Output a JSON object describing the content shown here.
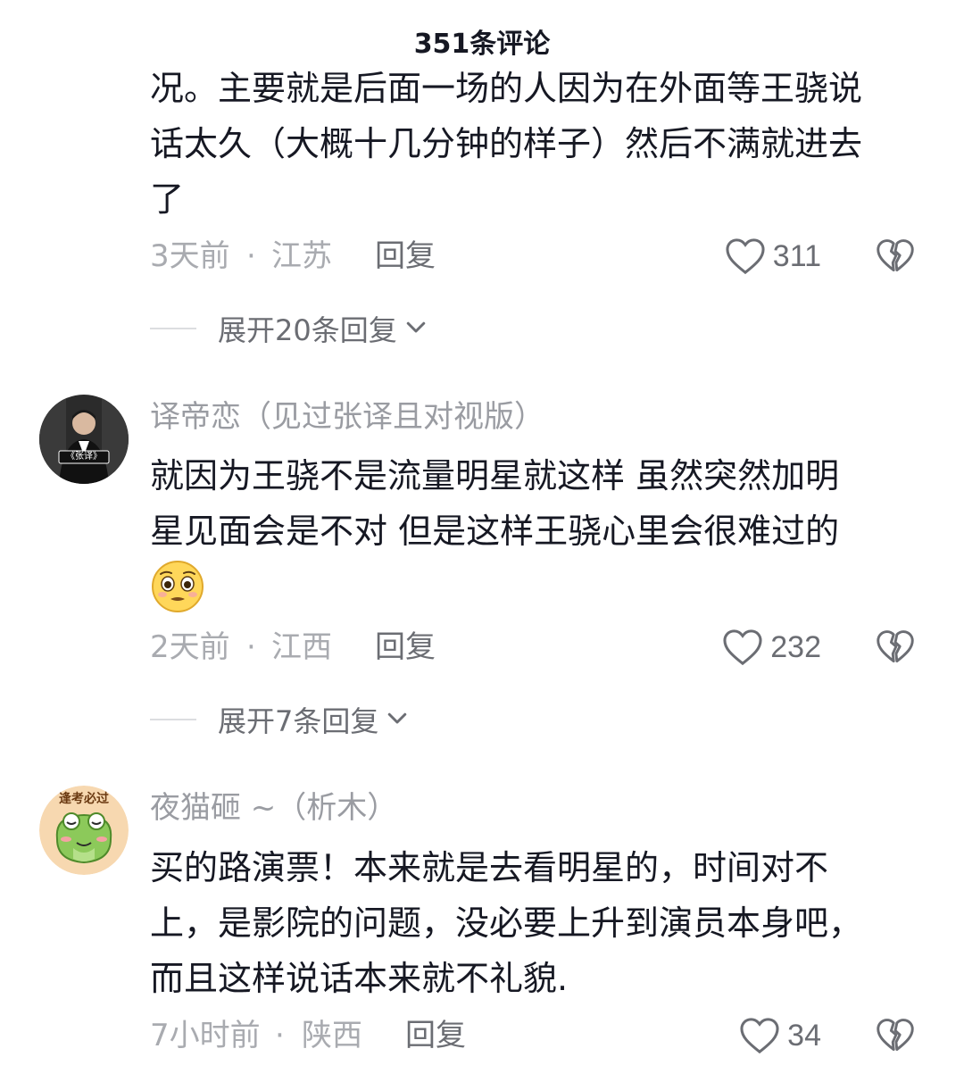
{
  "header": {
    "title": "351条评论"
  },
  "comments": [
    {
      "text": "况。主要就是后面一场的人因为在外面等王骁说\n话太久（大概十几分钟的样子）然后不满就进去\n了",
      "time": "3天前",
      "dot": "·",
      "location": "江苏",
      "reply_label": "回复",
      "likes": "311",
      "expand_label": "展开20条回复"
    },
    {
      "username": "译帝恋（见过张译且对视版）",
      "avatar_text": "《张译》",
      "text": "就因为王骁不是流量明星就这样 虽然突然加明\n星见面会是不对 但是这样王骁心里会很难过的",
      "emoji": "pleading-face-emoji",
      "time": "2天前",
      "dot": "·",
      "location": "江西",
      "reply_label": "回复",
      "likes": "232",
      "expand_label": "展开7条回复"
    },
    {
      "username": "夜猫砸 ~（析木）",
      "avatar_text": "逢考必过",
      "text": "买的路演票！本来就是去看明星的，时间对不\n上，是影院的问题，没必要上升到演员本身吧，\n而且这样说话本来就不礼貌.",
      "time": "7小时前",
      "dot": "·",
      "location": "陕西",
      "reply_label": "回复",
      "likes": "34"
    }
  ],
  "colors": {
    "text_primary": "#161823",
    "text_secondary": "#a9abb0",
    "accent_icon": "#6b6d73"
  },
  "icons": [
    "heart-outline-icon",
    "broken-heart-icon",
    "chevron-down-icon"
  ]
}
